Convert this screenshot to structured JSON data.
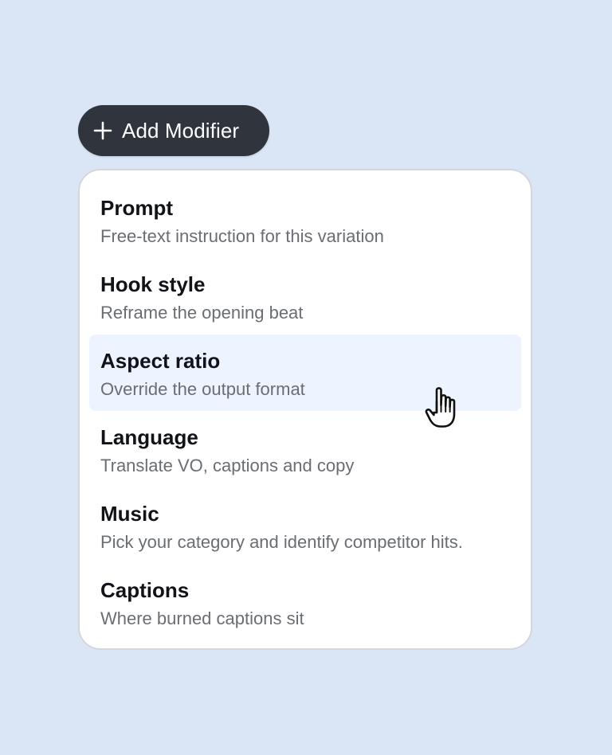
{
  "add_button": {
    "label": "Add Modifier",
    "icon": "plus-icon"
  },
  "menu": {
    "items": [
      {
        "title": "Prompt",
        "description": "Free-text instruction for this variation"
      },
      {
        "title": "Hook style",
        "description": "Reframe the opening beat"
      },
      {
        "title": "Aspect ratio",
        "description": "Override the output format",
        "hovered": true
      },
      {
        "title": "Language",
        "description": "Translate VO, captions and copy"
      },
      {
        "title": "Music",
        "description": "Pick your category and identify competitor hits."
      },
      {
        "title": "Captions",
        "description": "Where burned captions sit"
      }
    ]
  },
  "cursor": {
    "icon": "hand-pointer-icon"
  },
  "colors": {
    "background": "#dae6f6",
    "button": "#2f343d",
    "hover": "#edf4ff"
  }
}
